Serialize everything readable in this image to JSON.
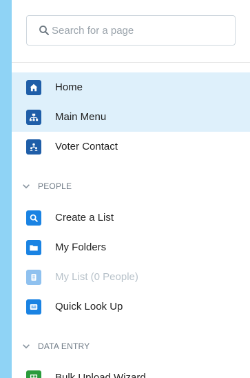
{
  "search": {
    "placeholder": "Search for a page"
  },
  "nav": {
    "items": [
      {
        "label": "Home",
        "icon": "home-icon",
        "color": "#1f5ea8",
        "active": true
      },
      {
        "label": "Main Menu",
        "icon": "sitemap-icon",
        "color": "#1f5ea8",
        "active": true
      },
      {
        "label": "Voter Contact",
        "icon": "people-network-icon",
        "color": "#1f5ea8",
        "active": false
      }
    ],
    "sections": [
      {
        "title": "PEOPLE",
        "items": [
          {
            "label": "Create a List",
            "icon": "search-icon",
            "color": "#1a83e3"
          },
          {
            "label": "My Folders",
            "icon": "folder-icon",
            "color": "#1a83e3"
          },
          {
            "label": "My List (0 People)",
            "icon": "list-icon",
            "color": "#8fc1ef",
            "disabled": true
          },
          {
            "label": "Quick Look Up",
            "icon": "id-card-icon",
            "color": "#1a83e3"
          }
        ]
      },
      {
        "title": "DATA ENTRY",
        "items": [
          {
            "label": "Bulk Upload Wizard",
            "icon": "upload-grid-icon",
            "color": "#2a9b3b"
          }
        ]
      }
    ]
  },
  "colors": {
    "sidebar_bg": "#8fd3f5",
    "active_bg": "#def0fb"
  }
}
